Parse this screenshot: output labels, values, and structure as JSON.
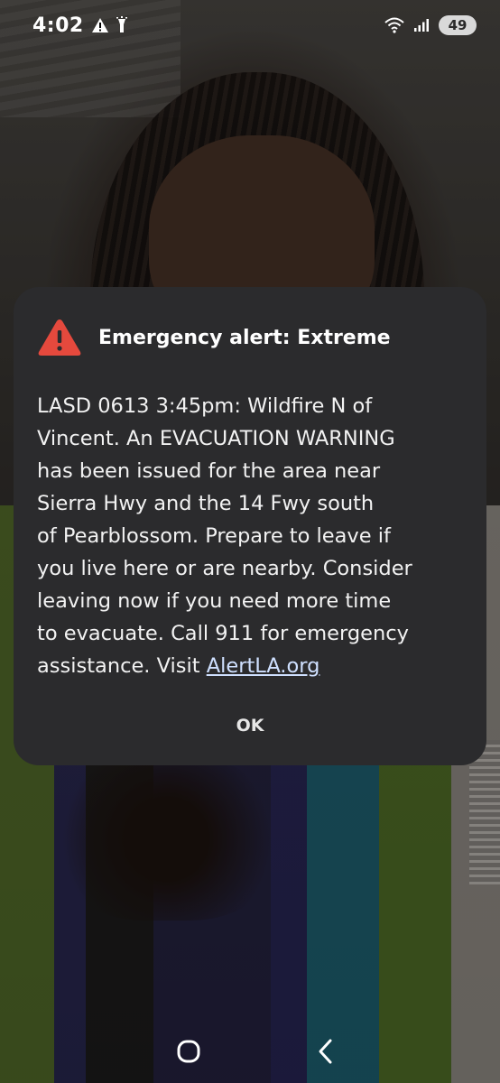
{
  "status_bar": {
    "time": "4:02",
    "battery": "49",
    "icons": [
      "warning-icon",
      "flashlight-icon",
      "wifi-icon",
      "signal-icon"
    ]
  },
  "alert": {
    "title": "Emergency alert: Extreme",
    "icon": "warning-triangle-icon",
    "accent_color": "#e5493d",
    "message_lines": [
      "LASD 0613 3:45pm: Wildfire N of",
      "Vincent. An EVACUATION WARNING",
      "has been issued for the area near",
      "Sierra Hwy and the 14 Fwy south",
      "of Pearblossom. Prepare to leave if",
      "you live here or are nearby. Consider",
      "leaving now if you need more time",
      "to evacuate. Call 911 for emergency"
    ],
    "last_line_prefix": "assistance. Visit ",
    "link_text": "AlertLA.org",
    "ok_label": "OK"
  },
  "nav_bar": {
    "icons": [
      "home-icon",
      "back-icon"
    ]
  }
}
